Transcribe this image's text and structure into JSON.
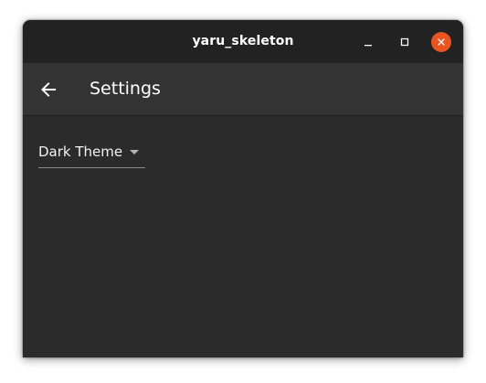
{
  "window": {
    "title": "yaru_skeleton",
    "controls": {
      "minimize_icon": "minimize-icon",
      "maximize_icon": "maximize-icon",
      "close_icon": "close-icon"
    }
  },
  "appbar": {
    "back_icon": "arrow-left-icon",
    "title": "Settings"
  },
  "settings": {
    "theme_dropdown": {
      "selected": "Dark Theme",
      "icon": "caret-down-icon"
    }
  },
  "colors": {
    "titlebar_bg": "#222222",
    "appbar_bg": "#333333",
    "content_bg": "#2b2b2b",
    "close_accent": "#e95420",
    "text": "#ffffff"
  }
}
